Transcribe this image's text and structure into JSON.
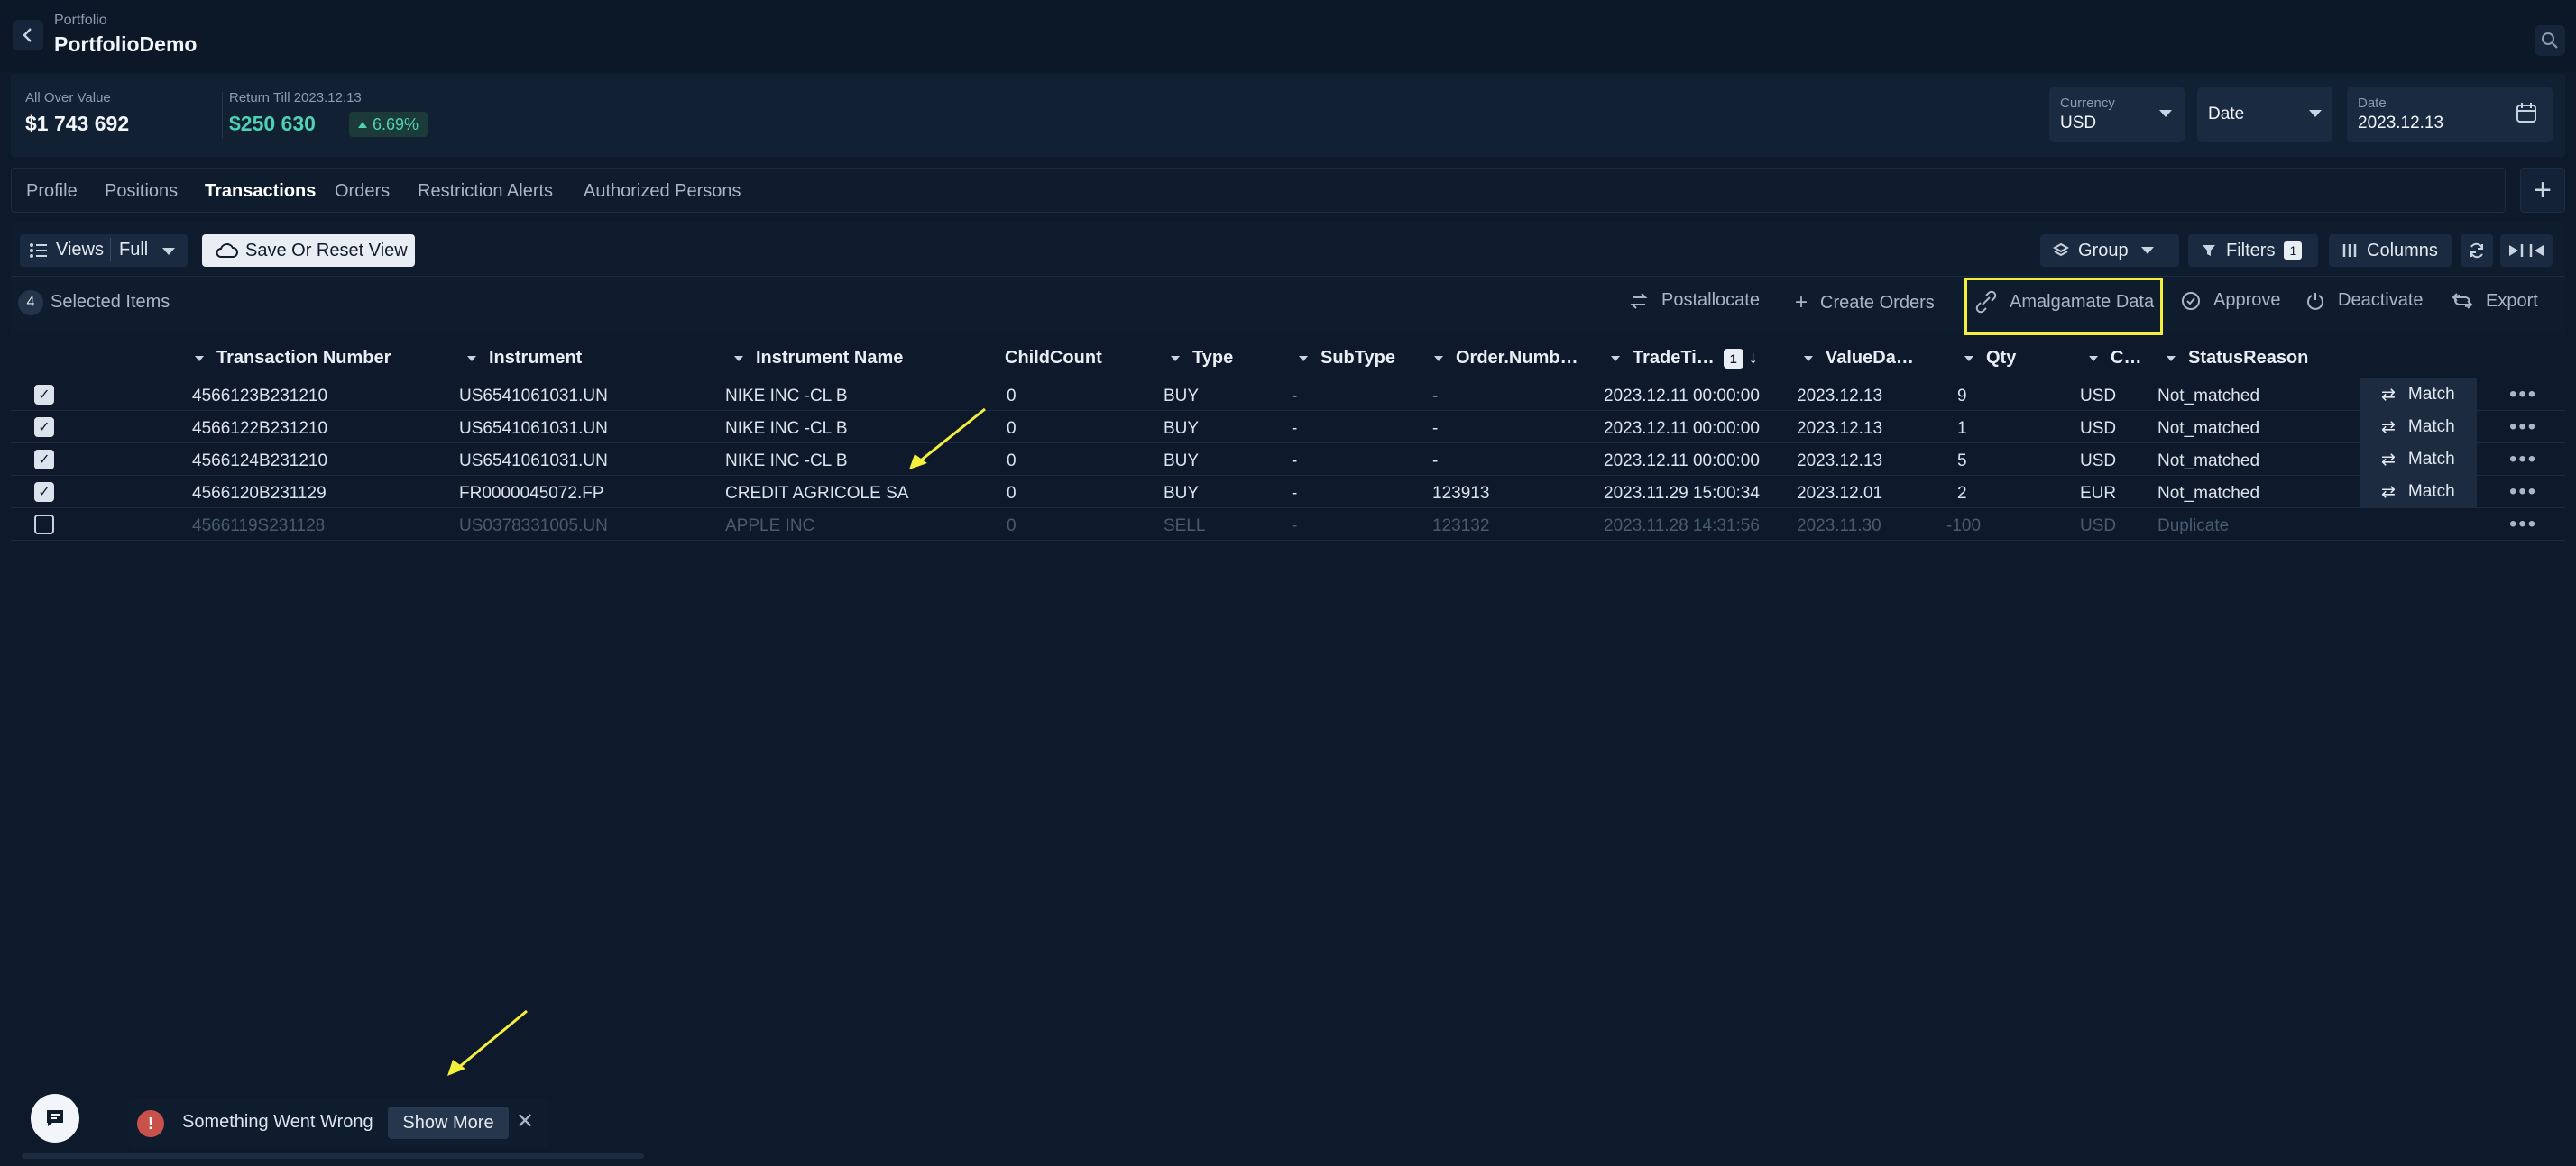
{
  "header": {
    "breadcrumb": "Portfolio",
    "title": "PortfolioDemo"
  },
  "summary": {
    "all_over_label": "All Over Value",
    "all_over_value": "$1 743 692",
    "return_label": "Return Till 2023.12.13",
    "return_value": "$250 630",
    "return_pct": "6.69%",
    "currency_label": "Currency",
    "currency_value": "USD",
    "date_select": "Date",
    "date_label": "Date",
    "date_value": "2023.12.13"
  },
  "tabs": [
    "Profile",
    "Positions",
    "Transactions",
    "Orders",
    "Restriction Alerts",
    "Authorized Persons"
  ],
  "active_tab": "Transactions",
  "toolbar": {
    "views_label": "Views",
    "views_value": "Full",
    "save_label": "Save Or Reset View",
    "group_label": "Group",
    "filters_label": "Filters",
    "filters_count": "1",
    "columns_label": "Columns"
  },
  "selection": {
    "count": "4",
    "text": "Selected Items"
  },
  "actions": [
    "Postallocate",
    "Create Orders",
    "Amalgamate Data",
    "Approve",
    "Deactivate",
    "Export"
  ],
  "columns": [
    "Transaction Number",
    "Instrument",
    "Instrument Name",
    "ChildCount",
    "Type",
    "SubType",
    "Order.Numb…",
    "TradeTi…",
    "ValueDa…",
    "Qty",
    "C…",
    "StatusReason"
  ],
  "sort_badge": "1",
  "rows": [
    {
      "checked": true,
      "txn": "4566123B231210",
      "instrument": "US6541061031.UN",
      "name": "NIKE INC -CL B",
      "child": "0",
      "type": "BUY",
      "subtype": "-",
      "order": "-",
      "trade": "2023.12.11 00:00:00",
      "value": "2023.12.13",
      "qty": "9",
      "cur": "USD",
      "status": "Not_matched",
      "action": "Match"
    },
    {
      "checked": true,
      "txn": "4566122B231210",
      "instrument": "US6541061031.UN",
      "name": "NIKE INC -CL B",
      "child": "0",
      "type": "BUY",
      "subtype": "-",
      "order": "-",
      "trade": "2023.12.11 00:00:00",
      "value": "2023.12.13",
      "qty": "1",
      "cur": "USD",
      "status": "Not_matched",
      "action": "Match"
    },
    {
      "checked": true,
      "txn": "4566124B231210",
      "instrument": "US6541061031.UN",
      "name": "NIKE INC -CL B",
      "child": "0",
      "type": "BUY",
      "subtype": "-",
      "order": "-",
      "trade": "2023.12.11 00:00:00",
      "value": "2023.12.13",
      "qty": "5",
      "cur": "USD",
      "status": "Not_matched",
      "action": "Match"
    },
    {
      "checked": true,
      "txn": "4566120B231129",
      "instrument": "FR0000045072.FP",
      "name": "CREDIT AGRICOLE SA",
      "child": "0",
      "type": "BUY",
      "subtype": "-",
      "order": "123913",
      "trade": "2023.11.29 15:00:34",
      "value": "2023.12.01",
      "qty": "2",
      "cur": "EUR",
      "status": "Not_matched",
      "action": "Match"
    },
    {
      "checked": false,
      "txn": "4566119S231128",
      "instrument": "US0378331005.UN",
      "name": "APPLE INC",
      "child": "0",
      "type": "SELL",
      "subtype": "-",
      "order": "123132",
      "trade": "2023.11.28 14:31:56",
      "value": "2023.11.30",
      "qty": "-100",
      "cur": "USD",
      "status": "Duplicate",
      "action": ""
    }
  ],
  "toast": {
    "message": "Something Went Wrong",
    "button": "Show More"
  },
  "colors": {
    "bg": "#0e1a2b",
    "accent_green": "#4fd1b4",
    "highlight": "#f4ef3c",
    "error": "#c8514b"
  }
}
